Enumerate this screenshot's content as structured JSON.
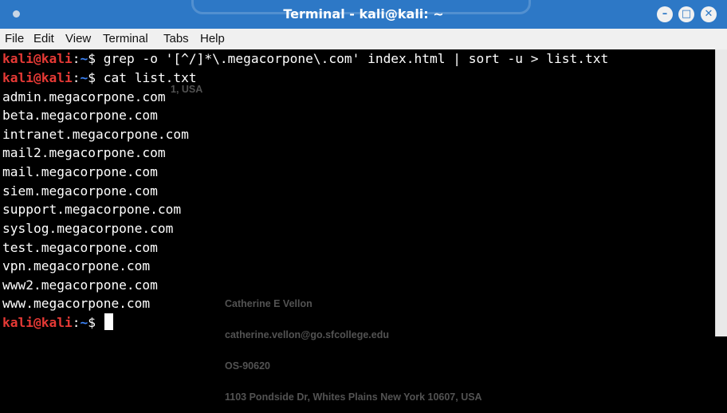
{
  "window": {
    "title": "Terminal - kali@kali: ~"
  },
  "menu": [
    "File",
    "Edit",
    "View",
    "Terminal",
    "Tabs",
    "Help"
  ],
  "prompt": {
    "user_host": "kali@kali",
    "separator": ":",
    "path": "~",
    "symbol": "$"
  },
  "commands": [
    "grep -o '[^/]*\\.megacorpone\\.com' index.html | sort -u > list.txt",
    "cat list.txt"
  ],
  "output": [
    "admin.megacorpone.com",
    "beta.megacorpone.com",
    "intranet.megacorpone.com",
    "mail2.megacorpone.com",
    "mail.megacorpone.com",
    "siem.megacorpone.com",
    "support.megacorpone.com",
    "syslog.megacorpone.com",
    "test.megacorpone.com",
    "vpn.megacorpone.com",
    "www2.megacorpone.com",
    "www.megacorpone.com"
  ],
  "watermark": {
    "ghost": "1, USA",
    "name": "Catherine E Vellon",
    "email": "catherine.vellon@go.sfcollege.edu",
    "code": "OS-90620",
    "address": "1103 Pondside Dr, Whites Plains New York 10607, USA"
  },
  "colors": {
    "titlebar": "#2d78c6",
    "prompt_user": "#e53935",
    "prompt_path": "#3b82f6",
    "terminal_bg": "#000000",
    "text": "#ffffff"
  },
  "icons": [
    "window-menu-dot-icon",
    "minimize-icon",
    "maximize-icon",
    "close-icon"
  ]
}
